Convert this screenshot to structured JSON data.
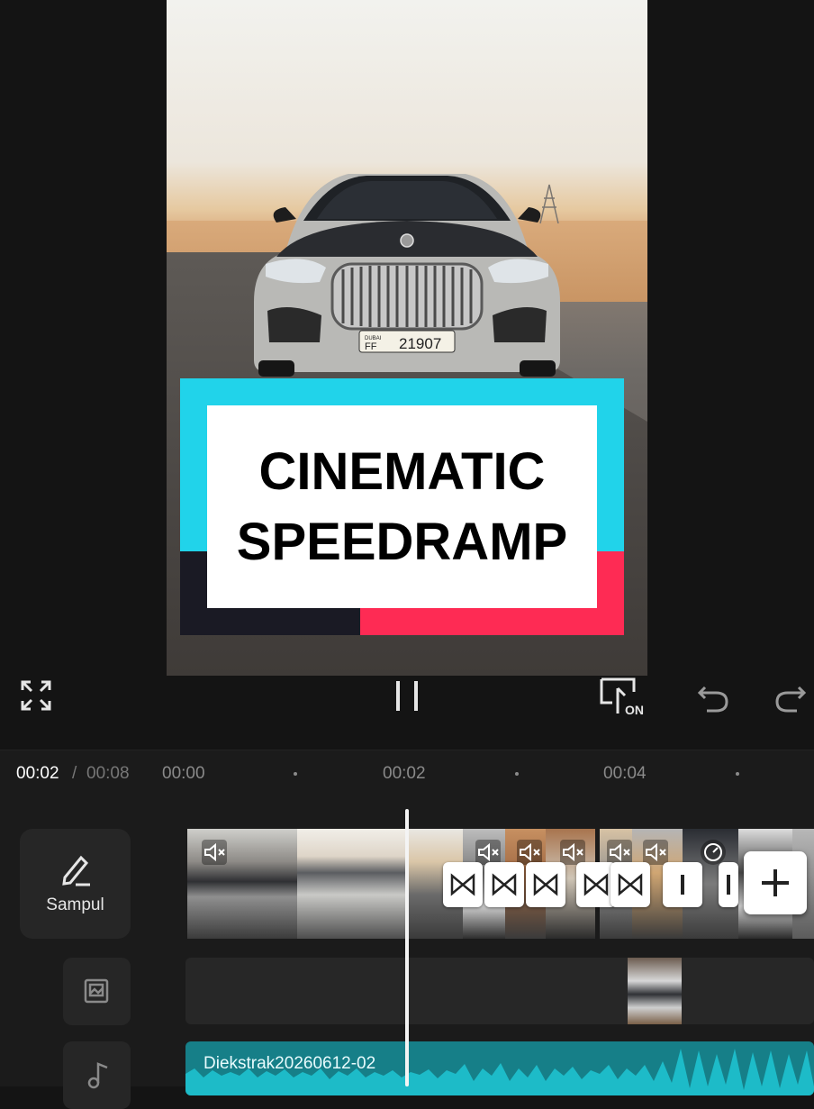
{
  "preview": {
    "title_line1": "CINEMATIC",
    "title_line2": "SPEEDRAMP",
    "plate_small": "DUBAI",
    "plate_letters": "FF",
    "plate_number": "21907"
  },
  "controls": {
    "fullscreen_icon": "fullscreen-icon",
    "play_pause_icon": "pause-icon",
    "keyframe_toggle_label": "ON",
    "undo_icon": "undo-icon",
    "redo_icon": "redo-icon"
  },
  "timeline": {
    "current_time": "00:02",
    "separator": "/",
    "total_time": "00:08",
    "ruler": [
      "00:00",
      "00:02",
      "00:04"
    ],
    "cover_label": "Sampul",
    "audio_clip_name": "Diekstrak20260612-02",
    "playhead_time": "00:02"
  },
  "colors": {
    "accent_cyan": "#21d3ea",
    "accent_pink": "#fe2b54",
    "accent_dark": "#1a1a24",
    "audio_track": "#167f88",
    "background": "#141414"
  }
}
